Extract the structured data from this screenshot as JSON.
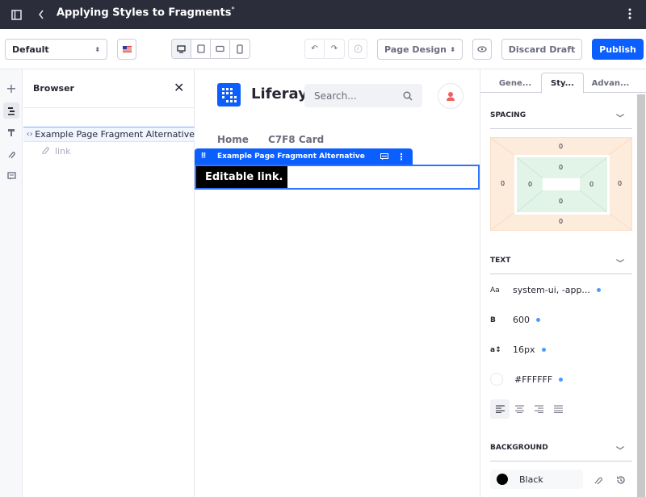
{
  "topbar": {
    "title": "Applying Styles to Fragments",
    "unsaved_marker": "*",
    "icons": [
      "sidebar-toggle-icon",
      "back-icon",
      "more-vertical-icon"
    ]
  },
  "toolbar": {
    "experience_select": "Default",
    "language_flag": "en-US",
    "viewports": [
      "desktop",
      "tablet",
      "landscape-phone",
      "portrait-phone"
    ],
    "active_viewport": "desktop",
    "undo_label": "Undo",
    "redo_label": "Redo",
    "history_label": "History",
    "mode_select": "Page Design",
    "preview_label": "Preview",
    "discard_label": "Discard Draft",
    "publish_label": "Publish"
  },
  "rail": {
    "items": [
      "add",
      "browser",
      "page-design-options",
      "mappings",
      "comments"
    ],
    "active": "browser"
  },
  "browser": {
    "title": "Browser",
    "tree": [
      {
        "label": "Example Page Fragment Alternative",
        "children": [
          {
            "label": "link"
          }
        ]
      }
    ]
  },
  "canvas": {
    "brand": "Liferay",
    "search_placeholder": "Search...",
    "nav": [
      "Home",
      "C7F8 Card"
    ],
    "fragment_label": "Example Page Fragment Alternative",
    "editable_text": "Editable link."
  },
  "panel": {
    "tabs": [
      {
        "label": "Gene...",
        "active": false
      },
      {
        "label": "Sty...",
        "active": true
      },
      {
        "label": "Advan...",
        "active": false
      }
    ],
    "spacing": {
      "title": "SPACING",
      "margin": {
        "top": "0",
        "right": "0",
        "bottom": "0",
        "left": "0"
      },
      "padding": {
        "top": "0",
        "right": "0",
        "bottom": "0",
        "left": "0"
      }
    },
    "text": {
      "title": "TEXT",
      "font_family": "system-ui, -app...",
      "font_weight": "600",
      "font_size": "16px",
      "color": "#FFFFFF",
      "align_options": [
        "left",
        "center",
        "right",
        "justify"
      ],
      "active_align": "left"
    },
    "background": {
      "title": "BACKGROUND",
      "color_name": "Black",
      "color_hex": "#000000"
    }
  },
  "colors": {
    "accent": "#0b5fff",
    "topbar": "#2b2e3a",
    "avatar": "#f25d5d"
  }
}
